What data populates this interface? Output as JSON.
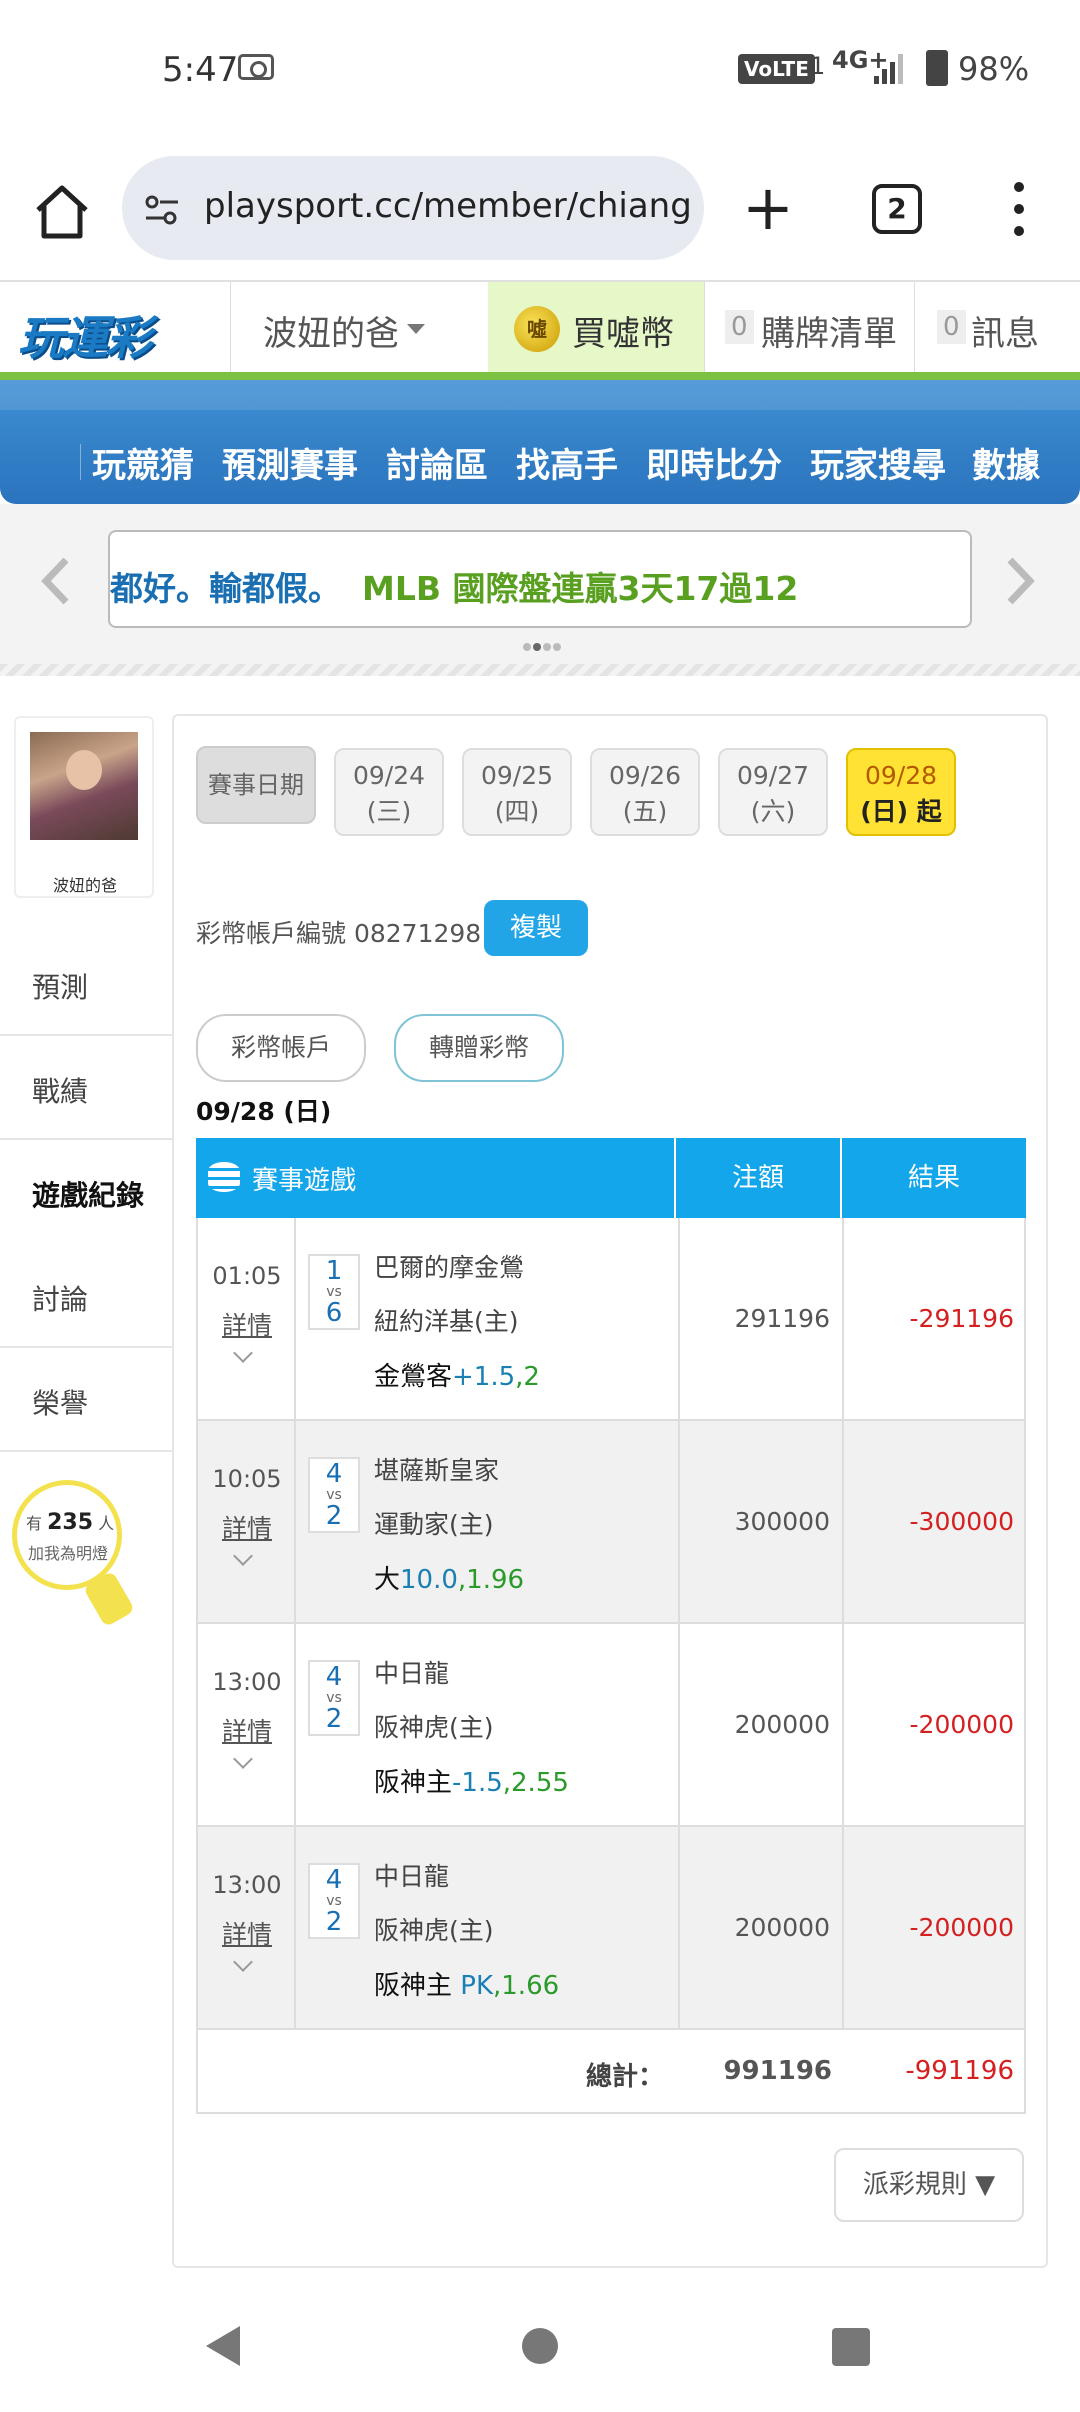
{
  "status": {
    "time": "5:47",
    "volte": "VoLTE",
    "sim": "1",
    "network": "4G+",
    "battery": "98%"
  },
  "browser": {
    "url": "playsport.cc/member/chiangkl",
    "tab_count": "2",
    "new_tab_symbol": "+"
  },
  "site": {
    "logo": "玩運彩",
    "username": "波妞的爸",
    "coin_icon_text": "噓",
    "coin_label": "買噓幣",
    "cart_count": "0",
    "cart_label": "購牌清單",
    "msg_count": "0",
    "msg_label": "訊息"
  },
  "nav": [
    "玩競猜",
    "預測賽事",
    "討論區",
    "找高手",
    "即時比分",
    "玩家搜尋",
    "數據"
  ],
  "marquee": {
    "part1": "都好。輸都假。",
    "part2": "MLB 國際盤連贏3天17過12"
  },
  "sidebar": {
    "name": "波妞的爸",
    "items": [
      "預測",
      "戰績",
      "遊戲紀錄",
      "討論",
      "榮譽"
    ],
    "active_index": 2,
    "bulb_prefix": "有",
    "bulb_count": "235",
    "bulb_suffix": "人",
    "bulb_text": "加我為明燈"
  },
  "panel": {
    "date_label": "賽事日期",
    "dates": [
      {
        "d": "09/24",
        "w": "(三)"
      },
      {
        "d": "09/25",
        "w": "(四)"
      },
      {
        "d": "09/26",
        "w": "(五)"
      },
      {
        "d": "09/27",
        "w": "(六)"
      },
      {
        "d": "09/28",
        "w": "(日) 起"
      }
    ],
    "account_text": "彩幣帳戶編號 08271298",
    "copy_label": "複製",
    "tab1": "彩幣帳戶",
    "tab2": "轉贈彩幣",
    "date_heading": "09/28 (日)",
    "table": {
      "col1": "賽事遊戲",
      "col2": "注額",
      "col3": "結果",
      "detail_label": "詳情",
      "vs": "vs",
      "rows": [
        {
          "time": "01:05",
          "a": "1",
          "b": "6",
          "team1": "巴爾的摩金鶯",
          "team2": "紐約洋基(主)",
          "pick": "金鶯客",
          "line": "+1.5",
          "odds": ",2",
          "amount": "291196",
          "result": "-291196"
        },
        {
          "time": "10:05",
          "a": "4",
          "b": "2",
          "team1": "堪薩斯皇家",
          "team2": "運動家(主)",
          "pick": "大",
          "line": "10.0",
          "odds": ",1.96",
          "amount": "300000",
          "result": "-300000"
        },
        {
          "time": "13:00",
          "a": "4",
          "b": "2",
          "team1": "中日龍",
          "team2": "阪神虎(主)",
          "pick": "阪神主",
          "line": "-1.5",
          "odds": ",2.55",
          "amount": "200000",
          "result": "-200000"
        },
        {
          "time": "13:00",
          "a": "4",
          "b": "2",
          "team1": "中日龍",
          "team2": "阪神虎(主)",
          "pick": "阪神主 ",
          "line": "PK",
          "odds": ",1.66",
          "amount": "200000",
          "result": "-200000"
        }
      ],
      "total_label": "總計：",
      "total_amount": "991196",
      "total_result": "-991196"
    },
    "rules_label": "派彩規則 ▼"
  }
}
